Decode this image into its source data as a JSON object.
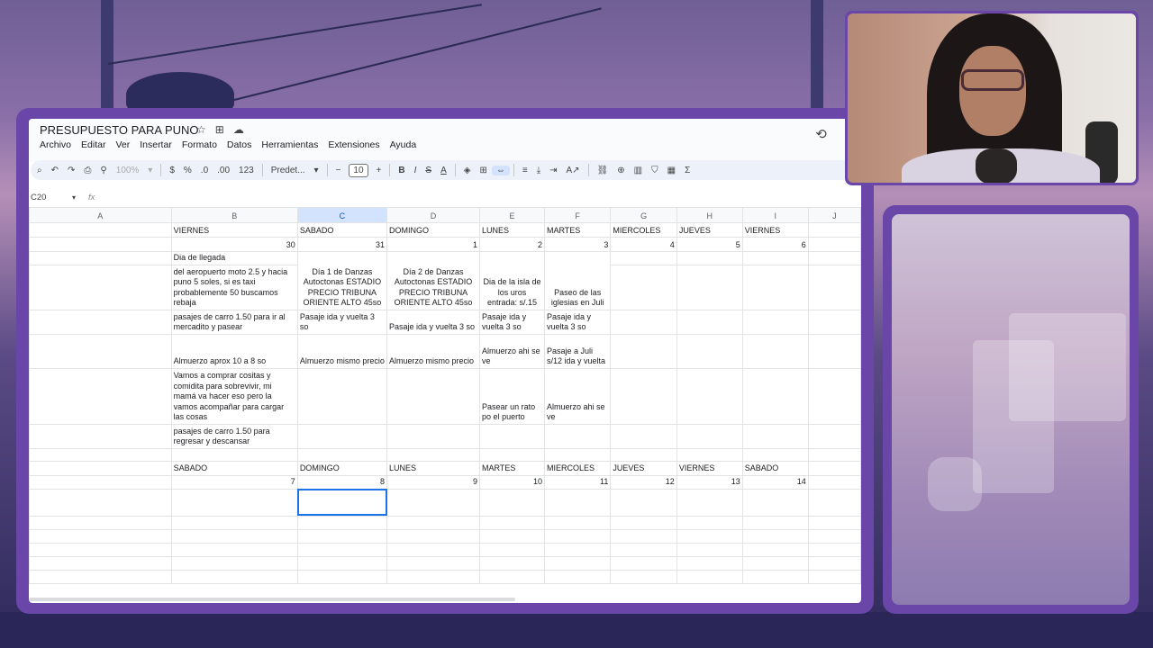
{
  "sheet": {
    "title": "PRESUPUESTO PARA PUNO",
    "menu": [
      "Archivo",
      "Editar",
      "Ver",
      "Insertar",
      "Formato",
      "Datos",
      "Herramientas",
      "Extensiones",
      "Ayuda"
    ],
    "toolbar": {
      "zoom": "100%",
      "currency": "$",
      "percent": "%",
      "decimal_decrease": ".0",
      "decimal_increase": ".00",
      "number_format": "123",
      "font": "Predet...",
      "font_size": "10",
      "minus": "−",
      "plus": "+",
      "bold": "B",
      "italic": "I",
      "strike": "S",
      "text_color": "A"
    },
    "name_box": "C20",
    "fx": "fx",
    "columns": [
      "A",
      "B",
      "C",
      "D",
      "E",
      "F",
      "G",
      "H",
      "I",
      "J"
    ],
    "selected_column": "C",
    "rows": {
      "r1": [
        "",
        "VIERNES",
        "SABADO",
        "DOMINGO",
        "LUNES",
        "MARTES",
        "MIERCOLES",
        "JUEVES",
        "VIERNES",
        ""
      ],
      "r2": [
        "",
        "30",
        "31",
        "1",
        "2",
        "3",
        "4",
        "5",
        "6",
        ""
      ],
      "r3": [
        "",
        "Dia de llegada",
        "",
        "",
        "",
        "",
        "",
        "",
        "",
        ""
      ],
      "r4": [
        "",
        "del aeropuerto moto 2.5 y hacia puno 5 soles, si es taxi probablemente 50 buscamos rebaja",
        "Día 1 de Danzas Autoctonas ESTADIO PRECIO TRIBUNA ORIENTE ALTO 45so",
        "Día 2 de Danzas Autoctonas ESTADIO PRECIO TRIBUNA ORIENTE ALTO 45so",
        "Dia de la isla de los uros entrada: s/.15",
        "Paseo de las iglesias en Juli",
        "",
        "",
        "",
        ""
      ],
      "r5": [
        "",
        "pasajes de carro 1.50 para ir al mercadito y pasear",
        "Pasaje ida y vuelta 3 so",
        "Pasaje ida y vuelta 3 so",
        "Pasaje ida y vuelta 3 so",
        "Pasaje ida y vuelta 3 so",
        "",
        "",
        "",
        ""
      ],
      "r6": [
        "",
        "Almuerzo aprox 10 a 8 so",
        "Almuerzo mismo precio",
        "Almuerzo mismo precio",
        "Almuerzo ahi se ve",
        "Pasaje a Juli s/12 ida y vuelta",
        "",
        "",
        "",
        ""
      ],
      "r7": [
        "",
        "Vamos a comprar cositas y comidita para sobrevivir, mi mamá va hacer eso pero la vamos acompañar para cargar las cosas",
        "",
        "",
        "Pasear un rato po el puerto",
        "Almuerzo ahi se ve",
        "",
        "",
        "",
        ""
      ],
      "r8": [
        "",
        "pasajes de carro 1.50 para regresar y descansar",
        "",
        "",
        "",
        "",
        "",
        "",
        "",
        ""
      ],
      "r9": [
        "",
        "",
        "",
        "",
        "",
        "",
        "",
        "",
        "",
        ""
      ],
      "r10": [
        "",
        "SABADO",
        "DOMINGO",
        "LUNES",
        "MARTES",
        "MIERCOLES",
        "JUEVES",
        "VIERNES",
        "SABADO",
        ""
      ],
      "r11": [
        "",
        "7",
        "8",
        "9",
        "10",
        "11",
        "12",
        "13",
        "14",
        ""
      ]
    }
  }
}
